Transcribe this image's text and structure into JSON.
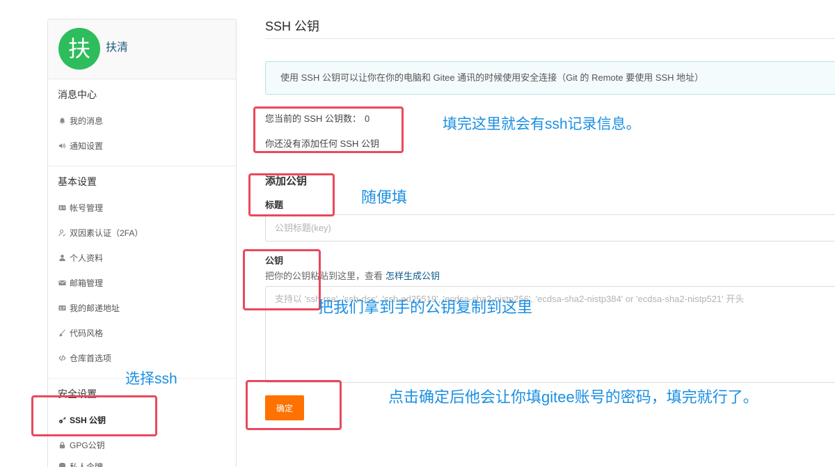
{
  "profile": {
    "avatar_text": "扶",
    "name": "扶清",
    "avatar_color": "#2ebd5d"
  },
  "sidebar": {
    "sections": [
      {
        "title": "消息中心",
        "items": [
          {
            "label": "我的消息",
            "icon": "bell-icon"
          },
          {
            "label": "通知设置",
            "icon": "volume-icon"
          }
        ]
      },
      {
        "title": "基本设置",
        "items": [
          {
            "label": "帐号管理",
            "icon": "id-card-icon"
          },
          {
            "label": "双因素认证（2FA）",
            "icon": "user-check-icon"
          },
          {
            "label": "个人资料",
            "icon": "user-icon"
          },
          {
            "label": "邮箱管理",
            "icon": "envelope-icon"
          },
          {
            "label": "我的邮递地址",
            "icon": "address-card-icon"
          },
          {
            "label": "代码风格",
            "icon": "brush-icon"
          },
          {
            "label": "仓库首选项",
            "icon": "code-icon"
          }
        ]
      },
      {
        "title": "安全设置",
        "items": [
          {
            "label": "SSH 公钥",
            "icon": "key-icon",
            "active": true
          },
          {
            "label": "GPG公钥",
            "icon": "lock-icon"
          },
          {
            "label": "私人令牌",
            "icon": "token-icon"
          }
        ]
      }
    ]
  },
  "main": {
    "page_title": "SSH 公钥",
    "info_text": "使用 SSH 公钥可以让你在你的电脑和 Gitee 通讯的时候使用安全连接（Git 的 Remote 要使用 SSH 地址）",
    "key_count_label": "您当前的 SSH 公钥数：",
    "key_count": "0",
    "empty_text": "你还没有添加任何 SSH 公钥",
    "add_heading": "添加公钥",
    "title_field": {
      "label": "标题",
      "placeholder": "公钥标题(key)"
    },
    "key_field": {
      "label": "公钥",
      "hint": "把你的公钥粘贴到这里，查看",
      "help_link": "怎样生成公钥",
      "placeholder": "支持以 'ssh-rsa', 'ssh-dss', 'ssh-ed25519', 'ecdsa-sha2-nistp256', 'ecdsa-sha2-nistp384' or 'ecdsa-sha2-nistp521' 开头"
    },
    "submit_label": "确定"
  },
  "annotations": {
    "notes": {
      "count_note": "填完这里就会有ssh记录信息。",
      "title_note": "随便填",
      "key_note": "把我们拿到手的公钥复制到这里",
      "submit_note": "点击确定后他会让你填gitee账号的密码，填完就行了。",
      "sidebar_note": "选择ssh"
    }
  },
  "colors": {
    "accent": "#fd7200",
    "link": "#0b5a8a",
    "profile_name": "#1d5b7e",
    "annotation_box": "#e9485c",
    "annotation_text": "#1b8fe2",
    "info_border": "#b7e0eb",
    "info_bg": "#f4fbfd"
  }
}
